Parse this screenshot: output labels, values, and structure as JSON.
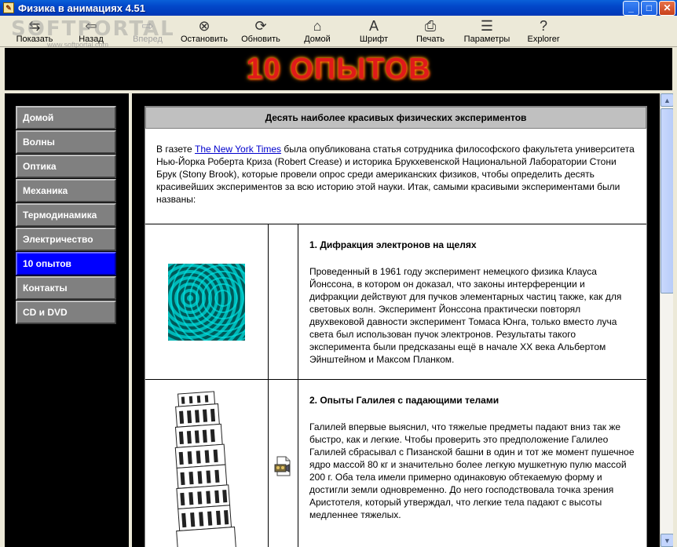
{
  "window": {
    "title": "Физика в анимациях 4.51",
    "minimize": "_",
    "maximize": "□",
    "close": "✕"
  },
  "toolbar": {
    "items": [
      {
        "label": "Показать",
        "icon": "show-icon",
        "glyph": "⇆",
        "enabled": true
      },
      {
        "label": "Назад",
        "icon": "back-icon",
        "glyph": "⇦",
        "enabled": true
      },
      {
        "label": "Вперед",
        "icon": "forward-icon",
        "glyph": "⇨",
        "enabled": false
      },
      {
        "label": "Остановить",
        "icon": "stop-icon",
        "glyph": "⊗",
        "enabled": true
      },
      {
        "label": "Обновить",
        "icon": "refresh-icon",
        "glyph": "⟳",
        "enabled": true
      },
      {
        "label": "Домой",
        "icon": "home-icon",
        "glyph": "⌂",
        "enabled": true
      },
      {
        "label": "Шрифт",
        "icon": "font-icon",
        "glyph": "A",
        "enabled": true
      },
      {
        "label": "Печать",
        "icon": "print-icon",
        "glyph": "⎙",
        "enabled": true
      },
      {
        "label": "Параметры",
        "icon": "options-icon",
        "glyph": "☰",
        "enabled": true
      },
      {
        "label": "Explorer",
        "icon": "explorer-icon",
        "glyph": "?",
        "enabled": true
      }
    ],
    "watermark": "SOFTPORTAL",
    "watermark_sub": "www.softportal.com"
  },
  "banner": {
    "title": "10 ОПЫТОВ"
  },
  "nav": {
    "items": [
      {
        "label": "Домой",
        "active": false
      },
      {
        "label": "Волны",
        "active": false
      },
      {
        "label": "Оптика",
        "active": false
      },
      {
        "label": "Механика",
        "active": false
      },
      {
        "label": "Термодинамика",
        "active": false
      },
      {
        "label": "Электричество",
        "active": false
      },
      {
        "label": "10 опытов",
        "active": true
      },
      {
        "label": "Контакты",
        "active": false
      },
      {
        "label": "CD и DVD",
        "active": false
      }
    ]
  },
  "content": {
    "header": "Десять наиболее красивых физических экспериментов",
    "intro_before_link": "В газете ",
    "intro_link": "The New York Times",
    "intro_after_link": " была опубликована статья сотрудника философского факультета университета Нью-Йорка Роберта Криза (Robert Crease) и историка Брукхевенской Национальной Лаборатории Стони Брук (Stony Brook), которые провели опрос среди американских физиков, чтобы определить десять красивейших экспериментов за всю историю этой науки. Итак, самыми красивыми экспериментами были названы:",
    "experiments": [
      {
        "title": "1. Дифракция электронов на щелях",
        "text": "Проведенный в 1961 году эксперимент немецкого физика Клауса Йонссона, в котором он доказал, что законы интерференции и дифракции действуют для пучков элементарных частиц также, как для световых волн. Эксперимент Йонссона практически повторял двухвековой давности эксперимент Томаса Юнга, только вместо луча света был использован пучок электронов.  Результаты такого эксперимента были предсказаны ещё в начале XX века Альбертом Эйнштейном и Максом Планком.",
        "image": "interference-pattern-image"
      },
      {
        "title": "2. Опыты Галилея с падающими телами",
        "text": "Галилей впервые выяснил, что тяжелые предметы падают вниз так же быстро, как и легкие. Чтобы проверить это предположение Галилео Галилей сбрасывал с Пизанской башни в один и тот же момент пушечное ядро массой 80 кг и значительно более легкую мушкетную пулю массой 200 г. Оба тела имели примерно одинаковую обтекаемую форму и достигли земли одновременно. До него господствовала точка зрения Аристотеля, который утверждал, что легкие тела падают с высоты медленнее тяжелых.",
        "image": "leaning-tower-of-pisa-image",
        "mid_icon": "video-file-icon"
      }
    ]
  },
  "scrollbar": {
    "up": "▲",
    "down": "▼"
  },
  "colors": {
    "titlebar": "#0247c9",
    "banner_text": "#e01a1a",
    "nav_active": "#0000ff",
    "nav_item": "#808080",
    "link": "#0000cc"
  }
}
